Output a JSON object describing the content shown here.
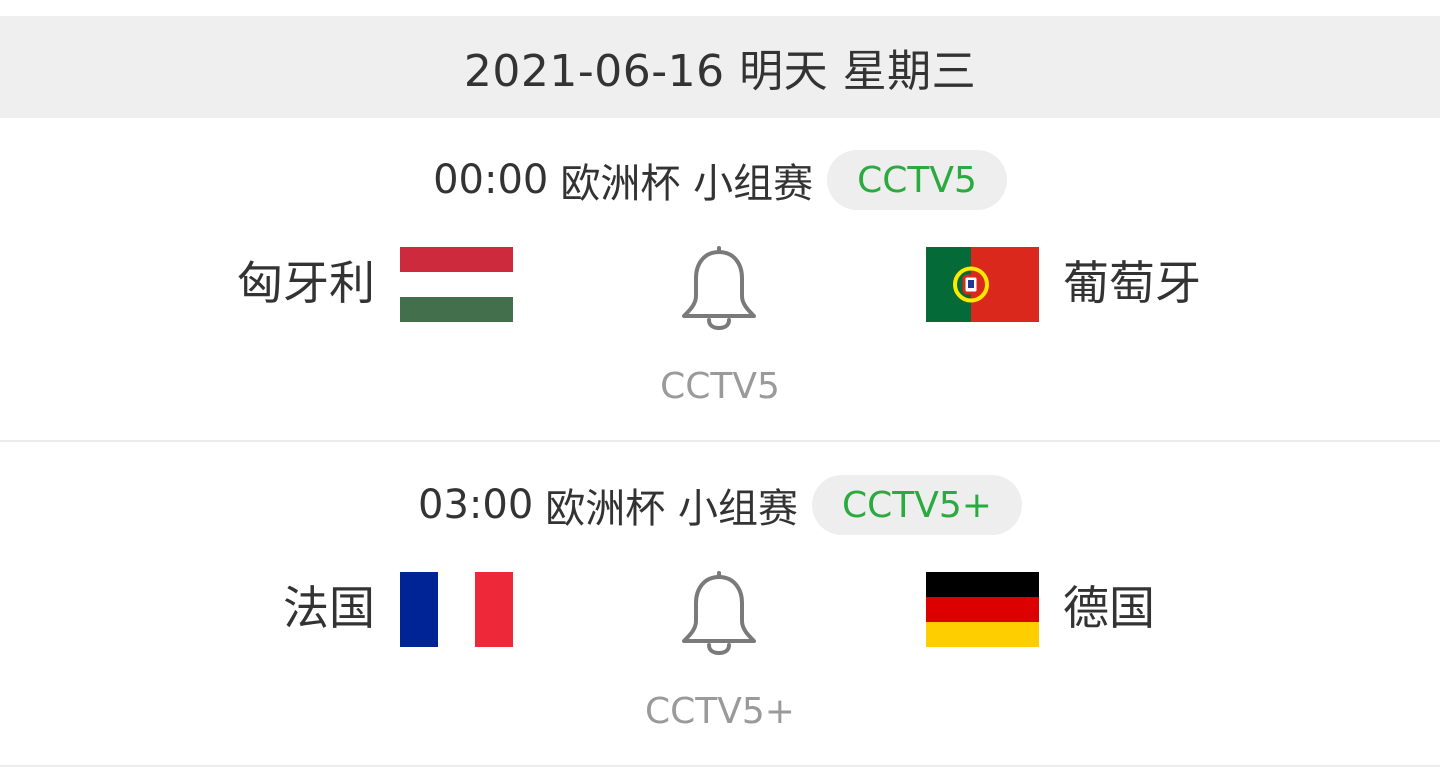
{
  "header": {
    "date_label": "2021-06-16 明天 星期三"
  },
  "matches": [
    {
      "time": "00:00",
      "competition": "欧洲杯 小组赛",
      "channel_badge": "CCTV5",
      "home_team": "匈牙利",
      "home_flag": "hungary-flag",
      "away_team": "葡萄牙",
      "away_flag": "portugal-flag",
      "reminder_icon": "bell-icon",
      "broadcast_channel": "CCTV5"
    },
    {
      "time": "03:00",
      "competition": "欧洲杯 小组赛",
      "channel_badge": "CCTV5+",
      "home_team": "法国",
      "home_flag": "france-flag",
      "away_team": "德国",
      "away_flag": "germany-flag",
      "reminder_icon": "bell-icon",
      "broadcast_channel": "CCTV5+"
    }
  ],
  "colors": {
    "header_bg": "#efefef",
    "channel_badge_text": "#2aaa3f",
    "channel_badge_bg": "#eeeeee",
    "secondary_text": "#9a9a9a",
    "primary_text": "#333333"
  }
}
